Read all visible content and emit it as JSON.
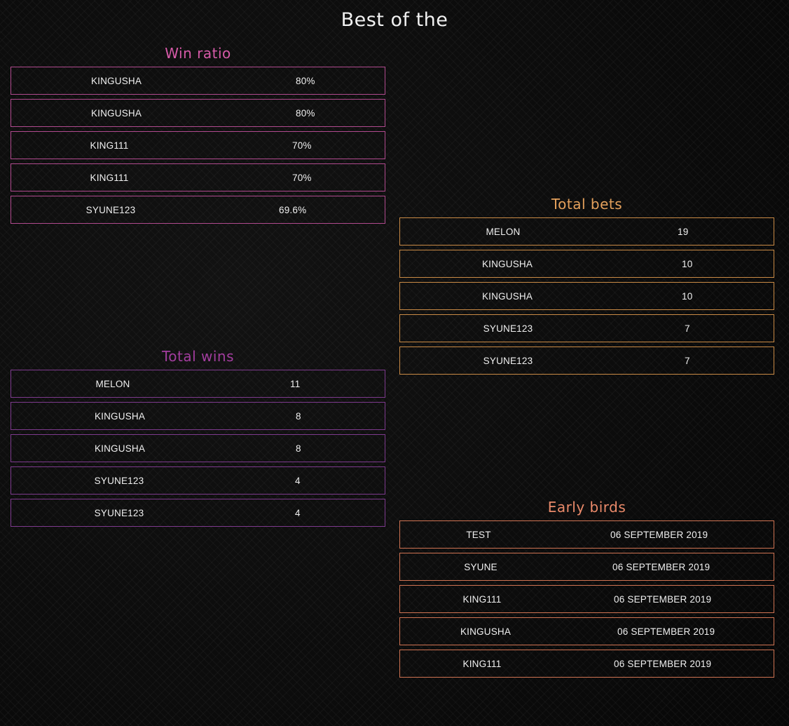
{
  "page": {
    "title": "Best of the"
  },
  "win_ratio": {
    "title": "Win ratio",
    "rows": [
      {
        "name": "KINGUSHA",
        "value": "80%"
      },
      {
        "name": "KINGUSHA",
        "value": "80%"
      },
      {
        "name": "KING111",
        "value": "70%"
      },
      {
        "name": "KING111",
        "value": "70%"
      },
      {
        "name": "SYUNE123",
        "value": "69.6%"
      }
    ]
  },
  "total_wins": {
    "title": "Total wins",
    "rows": [
      {
        "name": "MELON",
        "value": "11"
      },
      {
        "name": "KINGUSHA",
        "value": "8"
      },
      {
        "name": "KINGUSHA",
        "value": "8"
      },
      {
        "name": "SYUNE123",
        "value": "4"
      },
      {
        "name": "SYUNE123",
        "value": "4"
      }
    ]
  },
  "total_bets": {
    "title": "Total bets",
    "rows": [
      {
        "name": "MELON",
        "value": "19"
      },
      {
        "name": "KINGUSHA",
        "value": "10"
      },
      {
        "name": "KINGUSHA",
        "value": "10"
      },
      {
        "name": "SYUNE123",
        "value": "7"
      },
      {
        "name": "SYUNE123",
        "value": "7"
      }
    ]
  },
  "early_birds": {
    "title": "Early birds",
    "rows": [
      {
        "name": "TEST",
        "value": "06 SEPTEMBER 2019"
      },
      {
        "name": "SYUNE",
        "value": "06 SEPTEMBER 2019"
      },
      {
        "name": "KING111",
        "value": "06 SEPTEMBER 2019"
      },
      {
        "name": "KINGUSHA",
        "value": "06 SEPTEMBER 2019"
      },
      {
        "name": "KING111",
        "value": "06 SEPTEMBER 2019"
      }
    ]
  },
  "colors": {
    "background": "#0a0a0a",
    "win_ratio_accent": "#d65aa8",
    "total_wins_accent": "#a23d9e",
    "total_bets_accent": "#e5a15c",
    "early_birds_accent": "#ea8a6a"
  }
}
